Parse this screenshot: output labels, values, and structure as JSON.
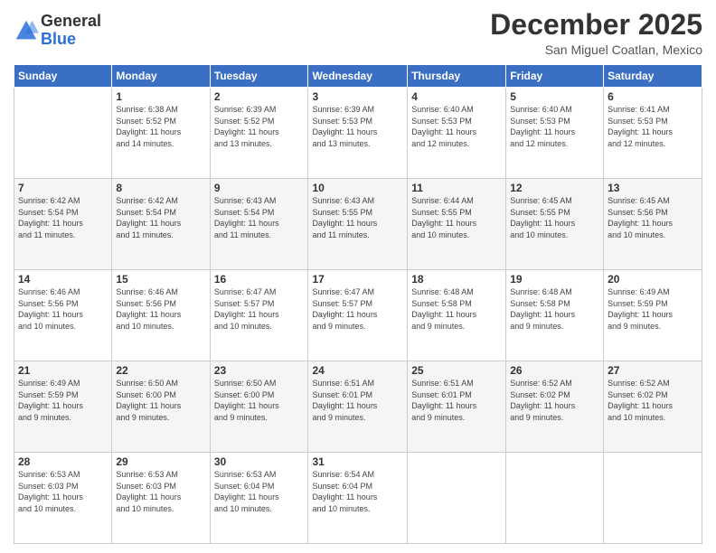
{
  "header": {
    "logo_general": "General",
    "logo_blue": "Blue",
    "month": "December 2025",
    "location": "San Miguel Coatlan, Mexico"
  },
  "weekdays": [
    "Sunday",
    "Monday",
    "Tuesday",
    "Wednesday",
    "Thursday",
    "Friday",
    "Saturday"
  ],
  "weeks": [
    [
      {
        "day": "",
        "info": ""
      },
      {
        "day": "1",
        "info": "Sunrise: 6:38 AM\nSunset: 5:52 PM\nDaylight: 11 hours\nand 14 minutes."
      },
      {
        "day": "2",
        "info": "Sunrise: 6:39 AM\nSunset: 5:52 PM\nDaylight: 11 hours\nand 13 minutes."
      },
      {
        "day": "3",
        "info": "Sunrise: 6:39 AM\nSunset: 5:53 PM\nDaylight: 11 hours\nand 13 minutes."
      },
      {
        "day": "4",
        "info": "Sunrise: 6:40 AM\nSunset: 5:53 PM\nDaylight: 11 hours\nand 12 minutes."
      },
      {
        "day": "5",
        "info": "Sunrise: 6:40 AM\nSunset: 5:53 PM\nDaylight: 11 hours\nand 12 minutes."
      },
      {
        "day": "6",
        "info": "Sunrise: 6:41 AM\nSunset: 5:53 PM\nDaylight: 11 hours\nand 12 minutes."
      }
    ],
    [
      {
        "day": "7",
        "info": "Sunrise: 6:42 AM\nSunset: 5:54 PM\nDaylight: 11 hours\nand 11 minutes."
      },
      {
        "day": "8",
        "info": "Sunrise: 6:42 AM\nSunset: 5:54 PM\nDaylight: 11 hours\nand 11 minutes."
      },
      {
        "day": "9",
        "info": "Sunrise: 6:43 AM\nSunset: 5:54 PM\nDaylight: 11 hours\nand 11 minutes."
      },
      {
        "day": "10",
        "info": "Sunrise: 6:43 AM\nSunset: 5:55 PM\nDaylight: 11 hours\nand 11 minutes."
      },
      {
        "day": "11",
        "info": "Sunrise: 6:44 AM\nSunset: 5:55 PM\nDaylight: 11 hours\nand 10 minutes."
      },
      {
        "day": "12",
        "info": "Sunrise: 6:45 AM\nSunset: 5:55 PM\nDaylight: 11 hours\nand 10 minutes."
      },
      {
        "day": "13",
        "info": "Sunrise: 6:45 AM\nSunset: 5:56 PM\nDaylight: 11 hours\nand 10 minutes."
      }
    ],
    [
      {
        "day": "14",
        "info": "Sunrise: 6:46 AM\nSunset: 5:56 PM\nDaylight: 11 hours\nand 10 minutes."
      },
      {
        "day": "15",
        "info": "Sunrise: 6:46 AM\nSunset: 5:56 PM\nDaylight: 11 hours\nand 10 minutes."
      },
      {
        "day": "16",
        "info": "Sunrise: 6:47 AM\nSunset: 5:57 PM\nDaylight: 11 hours\nand 10 minutes."
      },
      {
        "day": "17",
        "info": "Sunrise: 6:47 AM\nSunset: 5:57 PM\nDaylight: 11 hours\nand 9 minutes."
      },
      {
        "day": "18",
        "info": "Sunrise: 6:48 AM\nSunset: 5:58 PM\nDaylight: 11 hours\nand 9 minutes."
      },
      {
        "day": "19",
        "info": "Sunrise: 6:48 AM\nSunset: 5:58 PM\nDaylight: 11 hours\nand 9 minutes."
      },
      {
        "day": "20",
        "info": "Sunrise: 6:49 AM\nSunset: 5:59 PM\nDaylight: 11 hours\nand 9 minutes."
      }
    ],
    [
      {
        "day": "21",
        "info": "Sunrise: 6:49 AM\nSunset: 5:59 PM\nDaylight: 11 hours\nand 9 minutes."
      },
      {
        "day": "22",
        "info": "Sunrise: 6:50 AM\nSunset: 6:00 PM\nDaylight: 11 hours\nand 9 minutes."
      },
      {
        "day": "23",
        "info": "Sunrise: 6:50 AM\nSunset: 6:00 PM\nDaylight: 11 hours\nand 9 minutes."
      },
      {
        "day": "24",
        "info": "Sunrise: 6:51 AM\nSunset: 6:01 PM\nDaylight: 11 hours\nand 9 minutes."
      },
      {
        "day": "25",
        "info": "Sunrise: 6:51 AM\nSunset: 6:01 PM\nDaylight: 11 hours\nand 9 minutes."
      },
      {
        "day": "26",
        "info": "Sunrise: 6:52 AM\nSunset: 6:02 PM\nDaylight: 11 hours\nand 9 minutes."
      },
      {
        "day": "27",
        "info": "Sunrise: 6:52 AM\nSunset: 6:02 PM\nDaylight: 11 hours\nand 10 minutes."
      }
    ],
    [
      {
        "day": "28",
        "info": "Sunrise: 6:53 AM\nSunset: 6:03 PM\nDaylight: 11 hours\nand 10 minutes."
      },
      {
        "day": "29",
        "info": "Sunrise: 6:53 AM\nSunset: 6:03 PM\nDaylight: 11 hours\nand 10 minutes."
      },
      {
        "day": "30",
        "info": "Sunrise: 6:53 AM\nSunset: 6:04 PM\nDaylight: 11 hours\nand 10 minutes."
      },
      {
        "day": "31",
        "info": "Sunrise: 6:54 AM\nSunset: 6:04 PM\nDaylight: 11 hours\nand 10 minutes."
      },
      {
        "day": "",
        "info": ""
      },
      {
        "day": "",
        "info": ""
      },
      {
        "day": "",
        "info": ""
      }
    ]
  ]
}
